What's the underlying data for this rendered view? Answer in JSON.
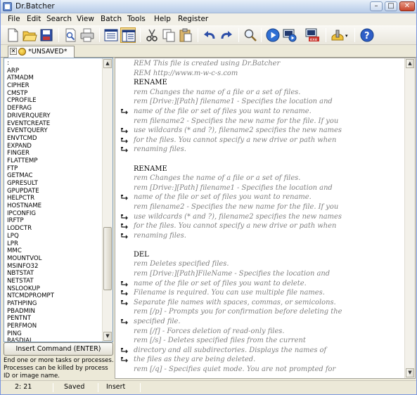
{
  "window": {
    "title": "Dr.Batcher",
    "controls": {
      "minimize": "–",
      "maximize": "□",
      "close": "✕"
    }
  },
  "menu": [
    "File",
    "Edit",
    "Search",
    "View",
    "Batch",
    "Tools",
    "Help",
    "Register"
  ],
  "toolbar": {
    "buttons": [
      {
        "name": "new-file-button",
        "icon": "new-file-icon"
      },
      {
        "name": "open-button",
        "icon": "folder-open-icon"
      },
      {
        "name": "save-button",
        "icon": "save-icon"
      },
      {
        "name": "print-preview-button",
        "icon": "print-preview-icon"
      },
      {
        "name": "print-button",
        "icon": "printer-icon"
      },
      {
        "name": "view-mode-1-button",
        "icon": "text-view-icon"
      },
      {
        "name": "view-mode-2-button",
        "icon": "split-view-icon"
      },
      {
        "name": "cut-button",
        "icon": "scissors-icon"
      },
      {
        "name": "copy-button",
        "icon": "copy-icon"
      },
      {
        "name": "paste-button",
        "icon": "paste-icon"
      },
      {
        "name": "undo-button",
        "icon": "undo-icon"
      },
      {
        "name": "redo-button",
        "icon": "redo-icon"
      },
      {
        "name": "find-button",
        "icon": "magnifier-icon"
      },
      {
        "name": "run-button",
        "icon": "play-icon"
      },
      {
        "name": "debug-button",
        "icon": "debug-icon"
      },
      {
        "name": "build-exe-button",
        "icon": "exe-icon"
      },
      {
        "name": "tools-button",
        "icon": "tools-icon"
      },
      {
        "name": "help-button",
        "icon": "help-icon"
      }
    ]
  },
  "tab": {
    "label": "*UNSAVED*"
  },
  "commands": {
    "items": [
      ":",
      "ARP",
      "ATMADM",
      "CIPHER",
      "CMSTP",
      "CPROFILE",
      "DEFRAG",
      "DRIVERQUERY",
      "EVENTCREATE",
      "EVENTQUERY",
      "ENVTCMD",
      "EXPAND",
      "FINGER",
      "FLATTEMP",
      "FTP",
      "GETMAC",
      "GPRESULT",
      "GPUPDATE",
      "HELPCTR",
      "HOSTNAME",
      "IPCONFIG",
      "IRFTP",
      "LODCTR",
      "LPQ",
      "LPR",
      "MMC",
      "MOUNTVOL",
      "MSINFO32",
      "NBTSTAT",
      "NETSTAT",
      "NSLOOKUP",
      "NTCMDPROMPT",
      "PATHPING",
      "PBADMIN",
      "PENTNT",
      "PERFMON",
      "PING",
      "RASDIAL"
    ],
    "insert_button": "Insert Command (ENTER)",
    "description": "End one or more tasks or processes. Processes can be killed by process ID or image name."
  },
  "editor": {
    "lines": [
      {
        "text": "REM This file is created using Dr.Batcher",
        "style": "remark",
        "wrap": false
      },
      {
        "text": "REM http://www.m-w-c-s.com",
        "style": "remark",
        "wrap": false
      },
      {
        "text": "RENAME",
        "style": "keyword",
        "wrap": false
      },
      {
        "text": "rem Changes the name of a file or a set of files.",
        "style": "remark",
        "wrap": false
      },
      {
        "text": "rem [Drive:][Path] filename1 - Specifies the location and",
        "style": "remark",
        "wrap": false
      },
      {
        "text": "name of the file or set of files you want to rename.",
        "style": "remark",
        "wrap": true
      },
      {
        "text": "rem filename2 - Specifies the new name for the file. If you",
        "style": "remark",
        "wrap": false
      },
      {
        "text": "use wildcards (* and ?), filename2 specifies the new names",
        "style": "remark",
        "wrap": true
      },
      {
        "text": "for the files. You cannot specify a new drive or path when",
        "style": "remark",
        "wrap": true
      },
      {
        "text": "renaming files.",
        "style": "remark",
        "wrap": true
      },
      {
        "text": "",
        "style": "remark",
        "wrap": false
      },
      {
        "text": "RENAME",
        "style": "keyword",
        "wrap": false
      },
      {
        "text": "rem Changes the name of a file or a set of files.",
        "style": "remark",
        "wrap": false
      },
      {
        "text": "rem [Drive:][Path] filename1 - Specifies the location and",
        "style": "remark",
        "wrap": false
      },
      {
        "text": "name of the file or set of files you want to rename.",
        "style": "remark",
        "wrap": true
      },
      {
        "text": "rem filename2 - Specifies the new name for the file. If you",
        "style": "remark",
        "wrap": false
      },
      {
        "text": "use wildcards (* and ?), filename2 specifies the new names",
        "style": "remark",
        "wrap": true
      },
      {
        "text": "for the files. You cannot specify a new drive or path when",
        "style": "remark",
        "wrap": true
      },
      {
        "text": "renaming files.",
        "style": "remark",
        "wrap": true
      },
      {
        "text": "",
        "style": "remark",
        "wrap": false
      },
      {
        "text": "DEL",
        "style": "keyword",
        "wrap": false
      },
      {
        "text": "rem Deletes specified files.",
        "style": "remark",
        "wrap": false
      },
      {
        "text": "rem [Drive:][Path]FileName - Specifies the location and",
        "style": "remark",
        "wrap": false
      },
      {
        "text": "name of the file or set of files you want to delete.",
        "style": "remark",
        "wrap": true
      },
      {
        "text": "Filename is required. You can use multiple file names.",
        "style": "remark",
        "wrap": true
      },
      {
        "text": "Separate file names with spaces, commas, or semicolons.",
        "style": "remark",
        "wrap": true
      },
      {
        "text": "rem [/p] - Prompts you for confirmation before deleting the",
        "style": "remark",
        "wrap": false
      },
      {
        "text": "specified file.",
        "style": "remark",
        "wrap": true
      },
      {
        "text": "rem [/f] - Forces deletion of read-only files.",
        "style": "remark",
        "wrap": false
      },
      {
        "text": "rem [/s] - Deletes specified files from the current",
        "style": "remark",
        "wrap": false
      },
      {
        "text": "directory and all subdirectories. Displays the names of",
        "style": "remark",
        "wrap": true
      },
      {
        "text": "the files as they are being deleted.",
        "style": "remark",
        "wrap": true
      },
      {
        "text": "rem [/q] - Specifies quiet mode. You are not prompted for",
        "style": "remark",
        "wrap": false
      }
    ]
  },
  "status": {
    "position": "2: 21",
    "saved": "Saved",
    "mode": "Insert"
  }
}
